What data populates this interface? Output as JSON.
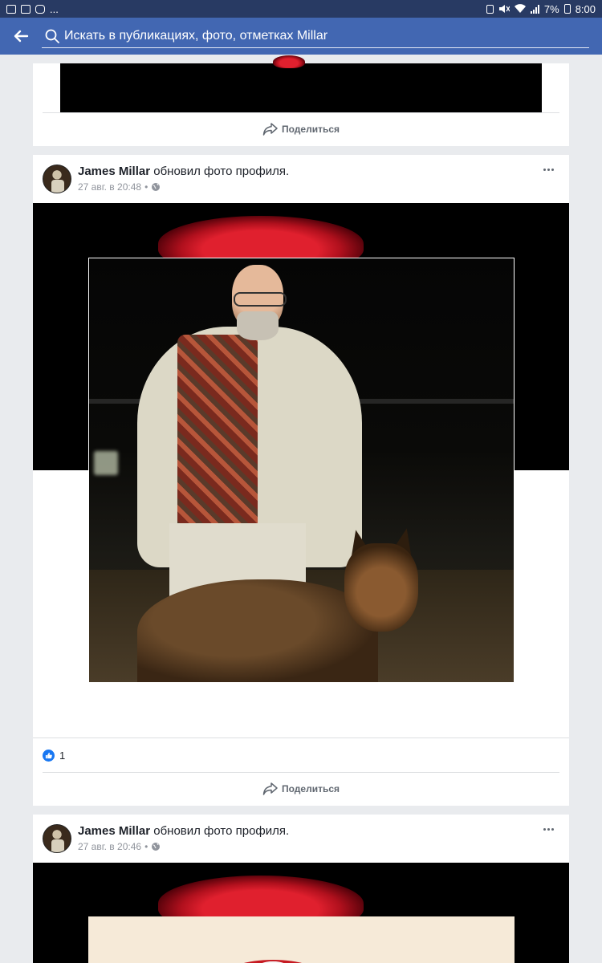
{
  "status_bar": {
    "left_icons": [
      "image-icon",
      "mail-icon",
      "instagram-icon"
    ],
    "left_more": "...",
    "battery": "7%",
    "time": "8:00"
  },
  "search": {
    "back_icon": "arrow-left-icon",
    "placeholder": "Искать в публикациях, фото, отметках Millar"
  },
  "top_card": {
    "share_label": "Поделиться"
  },
  "posts": [
    {
      "author": "James Millar",
      "action": "обновил фото профиля.",
      "timestamp": "27 авг. в 20:48",
      "separator": "•",
      "privacy_icon": "globe-icon",
      "likes_count": "1",
      "share_label": "Поделиться"
    },
    {
      "author": "James Millar",
      "action": "обновил фото профиля.",
      "timestamp": "27 авг. в 20:46",
      "separator": "•",
      "privacy_icon": "globe-icon"
    }
  ],
  "colors": {
    "header_blue": "#4267b2",
    "status_bar": "#283a63",
    "like_blue": "#1877f2",
    "page_bg": "#e9ebee"
  }
}
